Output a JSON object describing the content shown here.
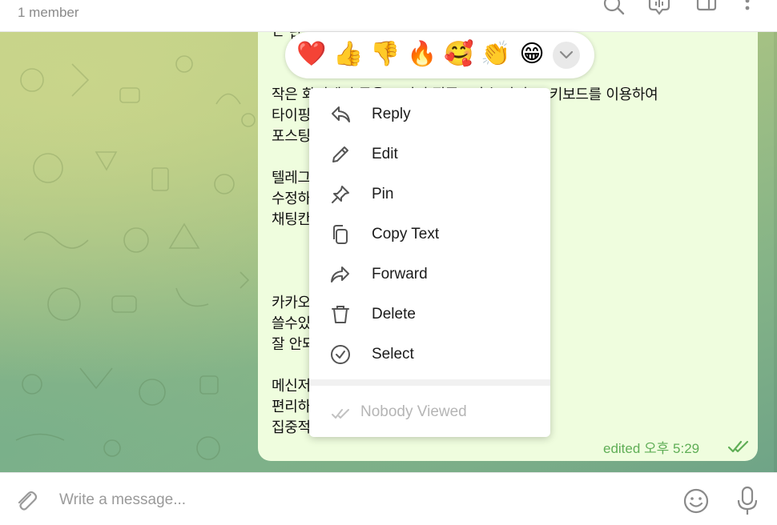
{
  "header": {
    "subtitle": "1 member",
    "icons": [
      "search-icon",
      "video-chat-icon",
      "sidebar-icon",
      "more-icon"
    ]
  },
  "message": {
    "lines": [
      {
        "text": "ㄴ 납"
      },
      {
        "text": "작은 화면에서 글을 쓰면서 집중도가 높아지고, 키보드를 이용하여"
      },
      {
        "text": "타이핑                                                                    가 있다. 그래서 많은"
      },
      {
        "text": "포스팅                                                                    니닐 필요는 없다."
      },
      {
        "text": "텔레그                                                        각나는 글감들을 적어두고"
      },
      {
        "text": "수정하                                                        nter키를 이용하여 1개"
      },
      {
        "text": "채팅칸"
      },
      {
        "text": "카카오                                                        성이 좋기 때문에 대안으로"
      },
      {
        "text": "쓸수있                                                        쓸때 블록 형태로 붙여넣기가"
      },
      {
        "text": "잘 안되"
      },
      {
        "text": "메신저                                                        만들면 관리하기에도"
      },
      {
        "text": "편리하                                                        . 무엇보다 빠르고"
      },
      {
        "text": "집중적                                                        갓이 좋다."
      }
    ],
    "meta": "edited 오후 5:29",
    "status": "read"
  },
  "reactions": {
    "emojis": [
      {
        "name": "red-heart",
        "glyph": "❤️"
      },
      {
        "name": "thumbs-up",
        "glyph": "👍"
      },
      {
        "name": "thumbs-down",
        "glyph": "👎"
      },
      {
        "name": "fire",
        "glyph": "🔥"
      },
      {
        "name": "smiling-face-with-hearts",
        "glyph": "🥰"
      },
      {
        "name": "clapping-hands",
        "glyph": "👏"
      },
      {
        "name": "grinning-face",
        "glyph": "😁"
      }
    ],
    "expand_icon": "chevron-down-icon"
  },
  "context_menu": {
    "items": [
      {
        "label": "Reply",
        "icon": "reply-icon"
      },
      {
        "label": "Edit",
        "icon": "pencil-icon"
      },
      {
        "label": "Pin",
        "icon": "pin-icon"
      },
      {
        "label": "Copy Text",
        "icon": "copy-icon"
      },
      {
        "label": "Forward",
        "icon": "forward-icon"
      },
      {
        "label": "Delete",
        "icon": "trash-icon"
      },
      {
        "label": "Select",
        "icon": "check-circle-icon"
      }
    ],
    "viewed_label": "Nobody Viewed"
  },
  "composer": {
    "placeholder": "Write a message...",
    "icons": [
      "attach-icon",
      "emoji-icon",
      "microphone-icon"
    ]
  },
  "colors": {
    "bubble": "#effdde",
    "accent_green": "#5fae56",
    "menu_bg": "#ffffff"
  }
}
